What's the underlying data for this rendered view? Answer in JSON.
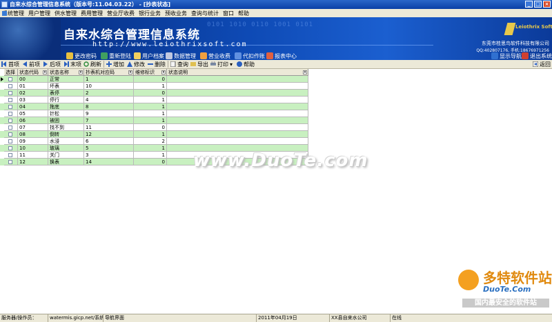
{
  "window": {
    "title": "自来水综合管理信息系统（版本号:11.04.03.22） - [抄表状态]",
    "buttons": [
      "minimize",
      "maximize",
      "close"
    ]
  },
  "menu": [
    "系统管理",
    "用户管理",
    "供水管理",
    "费用管理",
    "营业厅收费",
    "银行业务",
    "预收业务",
    "查询与统计",
    "窗口",
    "帮助"
  ],
  "banner": {
    "title": "自来水综合管理信息系统",
    "url": "http://www.leiothrixsoft.com",
    "logo_text": "Leiothrix Soft",
    "company": "东莞市桂思鸟软件科技有限公司",
    "contact": "QQ:402807176, 手机:18676971256"
  },
  "modules": {
    "left": [
      {
        "label": "更改密码",
        "icon": "key-icon"
      },
      {
        "label": "重新登陆",
        "icon": "login-icon"
      },
      {
        "label": "用户档案",
        "icon": "folder-icon"
      },
      {
        "label": "数据管理",
        "icon": "database-icon"
      },
      {
        "label": "营业收费",
        "icon": "cash-icon"
      },
      {
        "label": "代扣作账",
        "icon": "bank-icon"
      },
      {
        "label": "报表中心",
        "icon": "report-icon"
      }
    ],
    "right": [
      {
        "label": "显示导航",
        "icon": "navigation-icon"
      },
      {
        "label": "退出系统",
        "icon": "exit-icon"
      }
    ]
  },
  "toolbar": {
    "first": "首项",
    "prev": "前项",
    "next": "后项",
    "last": "末项",
    "refresh": "刷新",
    "add": "增加",
    "edit": "修改",
    "delete": "删除",
    "query": "查询",
    "export": "导出",
    "print": "打印",
    "help": "帮助",
    "back": "返回"
  },
  "table": {
    "columns": [
      "选择",
      "状态代码",
      "状态名称",
      "抄表机对应码",
      "维修标识",
      "状态说明"
    ],
    "rows": [
      {
        "code": "00",
        "name": "正常",
        "machine_code": "1",
        "repair": "0",
        "desc": ""
      },
      {
        "code": "01",
        "name": "坏表",
        "machine_code": "10",
        "repair": "1",
        "desc": ""
      },
      {
        "code": "02",
        "name": "表停",
        "machine_code": "2",
        "repair": "0",
        "desc": ""
      },
      {
        "code": "03",
        "name": "停行",
        "machine_code": "4",
        "repair": "1",
        "desc": ""
      },
      {
        "code": "04",
        "name": "拖底",
        "machine_code": "8",
        "repair": "1",
        "desc": ""
      },
      {
        "code": "05",
        "name": "针松",
        "machine_code": "9",
        "repair": "1",
        "desc": ""
      },
      {
        "code": "06",
        "name": "被困",
        "machine_code": "7",
        "repair": "1",
        "desc": ""
      },
      {
        "code": "07",
        "name": "找不到",
        "machine_code": "11",
        "repair": "0",
        "desc": ""
      },
      {
        "code": "08",
        "name": "倒转",
        "machine_code": "12",
        "repair": "1",
        "desc": ""
      },
      {
        "code": "09",
        "name": "水浸",
        "machine_code": "6",
        "repair": "2",
        "desc": ""
      },
      {
        "code": "10",
        "name": "玻璃",
        "machine_code": "5",
        "repair": "1",
        "desc": ""
      },
      {
        "code": "11",
        "name": "关门",
        "machine_code": "3",
        "repair": "1",
        "desc": ""
      },
      {
        "code": "12",
        "name": "换表",
        "machine_code": "14",
        "repair": "0",
        "desc": ""
      }
    ]
  },
  "watermarks": {
    "center": "www.DuoTe.com",
    "corner_title": "多特软件站",
    "corner_url": "DuoTe.Com",
    "corner_slogan": "国内最安全的软件站"
  },
  "status": {
    "server": "服务器/操作员：",
    "server_value": "watermis.gicp.net/系统管理",
    "screen": "导航界面",
    "date": "2011年04月19日",
    "org": "XX县自来水公司",
    "state": "在线"
  },
  "colors": {
    "title_bar": "#0a3fa6",
    "row_alt": "#c8f0c0",
    "banner": "#0e4ab5"
  }
}
